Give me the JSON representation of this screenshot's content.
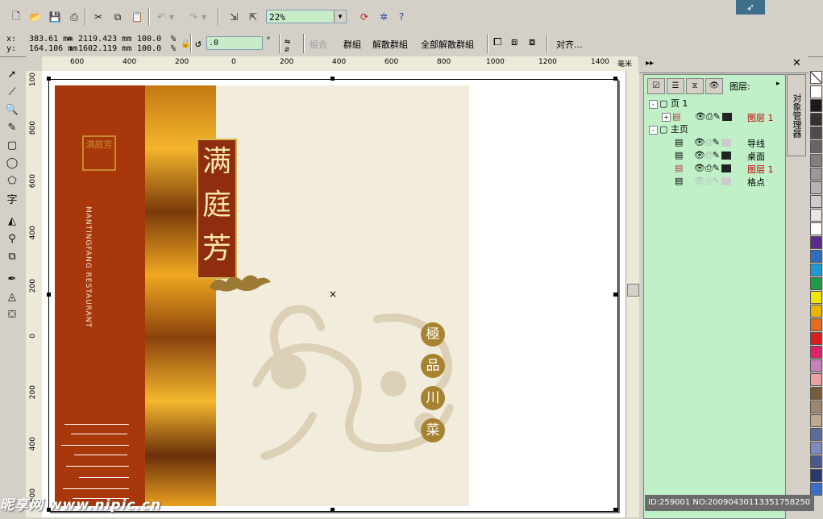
{
  "toolbar": {
    "zoom": "22%",
    "icons": [
      "new-doc-icon",
      "open-icon",
      "save-icon",
      "print-icon",
      "cut-icon",
      "copy-icon",
      "paste-icon",
      "undo-icon",
      "redo-icon",
      "import-icon",
      "export-icon",
      "zoom-dropdown",
      "app-launcher-icon",
      "corel-online-icon",
      "help-icon"
    ]
  },
  "propbar": {
    "x_label": "x:",
    "y_label": "y:",
    "x_value": "383.61 mm",
    "y_value": "164.106 mm",
    "w_value": "2119.423 mm",
    "h_value": "1602.119 mm",
    "scale_w": "100.0",
    "scale_h": "100.0",
    "pct": "%",
    "rotation": ".0",
    "degree": "°",
    "combine": "组合",
    "group": "群組",
    "ungroup": "解散群組",
    "ungroup_all": "全部解散群組",
    "align": "对齐..."
  },
  "ruler": {
    "h_ticks": [
      "600",
      "400",
      "200",
      "0",
      "200",
      "400",
      "600",
      "800",
      "1000",
      "1200",
      "1400"
    ],
    "h_unit": "毫米",
    "v_ticks": [
      "100",
      "800",
      "600",
      "400",
      "200",
      "0",
      "200",
      "400",
      "600"
    ]
  },
  "artwork": {
    "title_chars": [
      "满",
      "庭",
      "芳"
    ],
    "seal_text": "满庭芳",
    "english": "MANTINGFANG RESTAURANT",
    "circle_chars": [
      "極",
      "品",
      "川",
      "菜"
    ]
  },
  "docker": {
    "layers_label": "图层:",
    "side_tab": "对象管理器",
    "tree": [
      {
        "label": "页 1",
        "indent": 0,
        "expand": "-"
      },
      {
        "label": "图层 1",
        "indent": 1,
        "expand": "+",
        "red": true
      },
      {
        "label": "主页",
        "indent": 0,
        "expand": "-"
      },
      {
        "label": "导线",
        "indent": 1,
        "expand": ""
      },
      {
        "label": "桌面",
        "indent": 1,
        "expand": ""
      },
      {
        "label": "图层 1",
        "indent": 1,
        "expand": "",
        "red": true
      },
      {
        "label": "格点",
        "indent": 1,
        "expand": ""
      }
    ]
  },
  "palette": [
    "#ffffff",
    "#1a1a1a",
    "#333333",
    "#4d4d4d",
    "#666666",
    "#808080",
    "#999999",
    "#b3b3b3",
    "#cccccc",
    "#e6e6e6",
    "#ffffff",
    "#5a2a8c",
    "#2d6ec2",
    "#1a9bd7",
    "#1f9a46",
    "#f2e600",
    "#e8b400",
    "#e86a1a",
    "#d81e1e",
    "#e0206a",
    "#c880b8",
    "#e8a0a0",
    "#7a5a3c",
    "#a08870",
    "#c0a890",
    "#5a6e9c",
    "#7a8cc0",
    "#4a5a8c",
    "#2a3a6c",
    "#3a6ec8"
  ],
  "watermark": "昵享网 www.nipic.cn",
  "id_line": "ID:259001 NO:20090430113351758250"
}
